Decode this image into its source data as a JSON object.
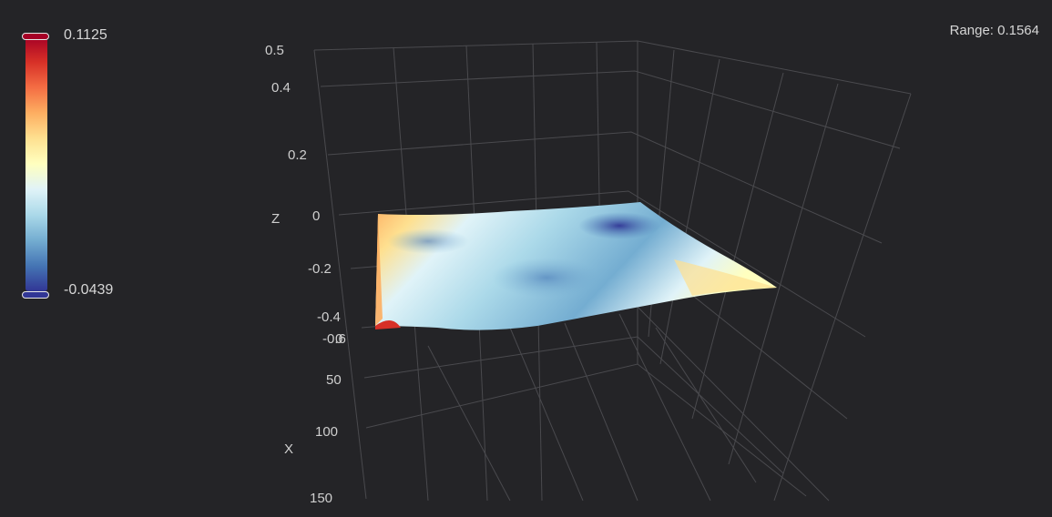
{
  "range_label": "Range: 0.1564",
  "colorbar": {
    "max_label": "0.1125",
    "min_label": "-0.0439",
    "stops": [
      "#313695",
      "#4575b4",
      "#74add1",
      "#abd9e9",
      "#e0f3f8",
      "#ffffbf",
      "#fee090",
      "#fdae61",
      "#f46d43",
      "#d73027",
      "#a50026"
    ]
  },
  "chart_data": {
    "type": "surface",
    "z_axis": {
      "title": "Z",
      "ticks": [
        "0.5",
        "0.4",
        "0.2",
        "0",
        "-0.2",
        "-0.4",
        "-0.6"
      ]
    },
    "x_axis": {
      "title": "X",
      "ticks": [
        "0",
        "50",
        "100",
        "150"
      ]
    },
    "grid": true,
    "value_range": [
      -0.0439,
      0.1125
    ],
    "surface_description_values": "height field with range 0.1564; blue lows near back-right, red highs at front-left edge"
  }
}
